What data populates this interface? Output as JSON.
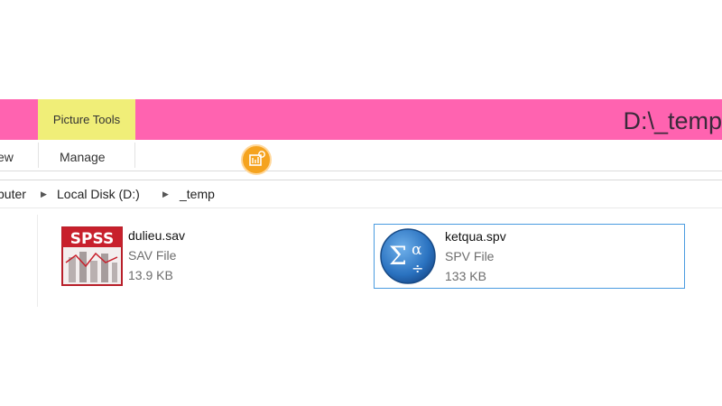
{
  "window": {
    "title": "D:\\_temp",
    "contextual_tab": "Picture Tools"
  },
  "ribbon": {
    "tabs": [
      "ew",
      "Manage"
    ]
  },
  "address_bar": {
    "crumbs": [
      "puter",
      "Local Disk (D:)",
      "_temp"
    ]
  },
  "files": [
    {
      "name": "dulieu.sav",
      "type": "SAV File",
      "size": "13.9 KB",
      "icon": "spss-data-icon",
      "selected": false
    },
    {
      "name": "ketqua.spv",
      "type": "SPV File",
      "size": "133 KB",
      "icon": "spss-output-icon",
      "selected": true
    }
  ],
  "icons": {
    "spss_logo_text": "SPSS",
    "spv_symbols": [
      "Σ",
      "α",
      "÷"
    ]
  },
  "colors": {
    "titlebar": "#ff63b0",
    "contextual_tab": "#f0ee78",
    "selection_border": "#4a9be0",
    "badge": "#f5a31f"
  }
}
